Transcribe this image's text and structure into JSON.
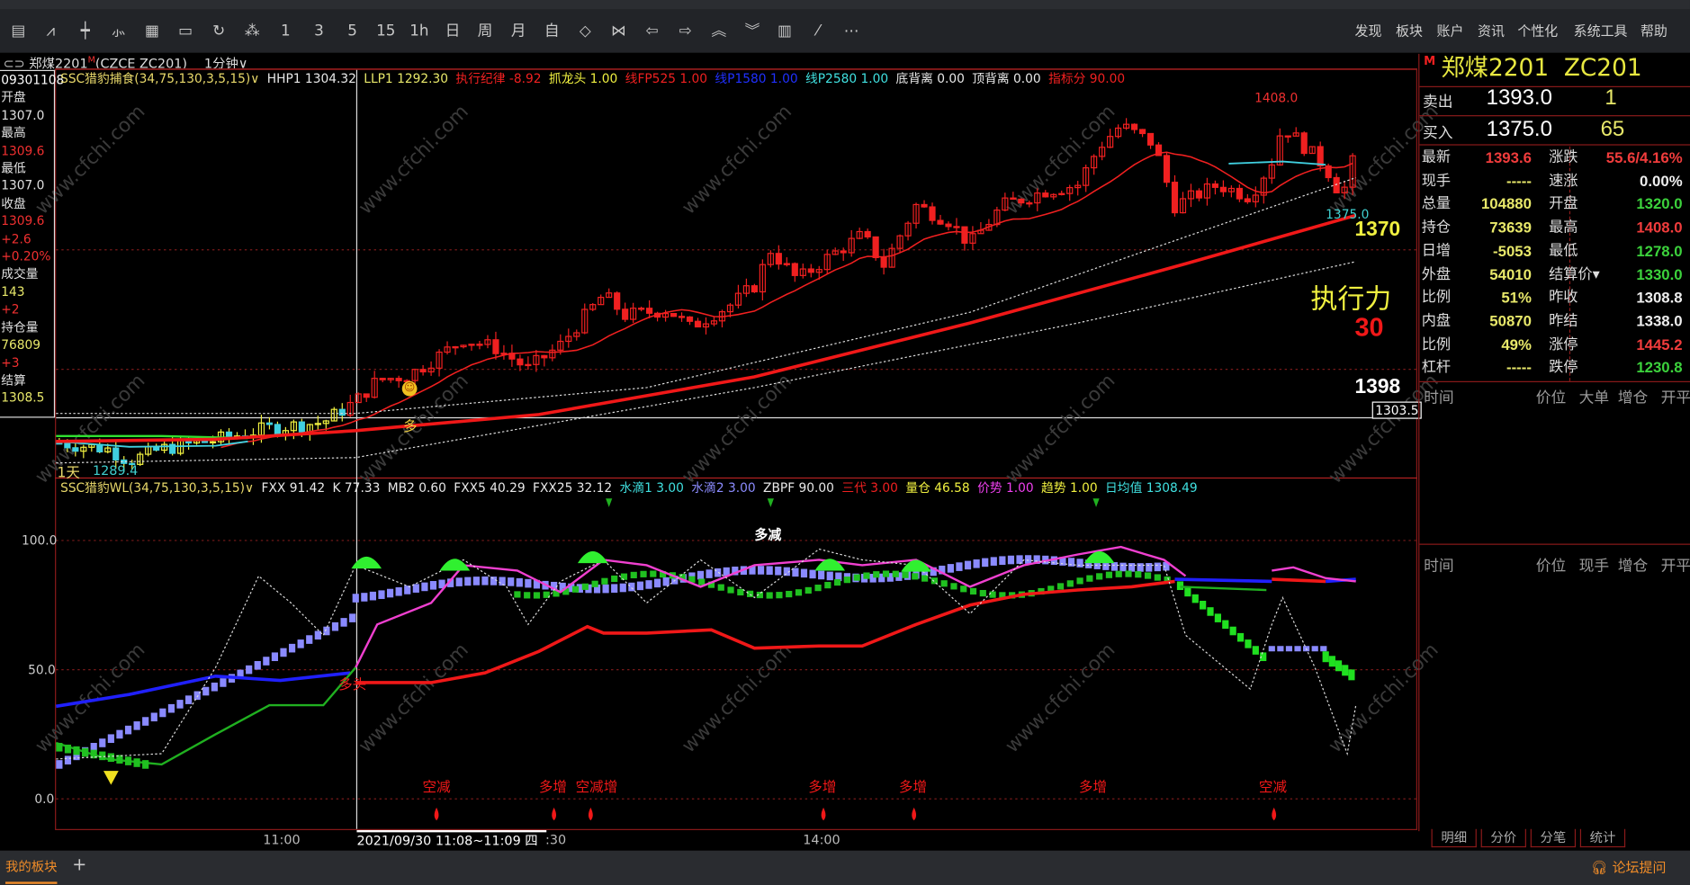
{
  "toolbar": {
    "icons": [
      "table-icon",
      "line-chart-icon",
      "candle-icon",
      "draw-icon",
      "stats-icon",
      "save-icon",
      "refresh-icon",
      "indicator-icon",
      "period-1-icon",
      "period-3-icon",
      "period-5-icon",
      "period-15-icon",
      "period-1h-icon",
      "period-day-icon",
      "period-week-icon",
      "period-month-icon",
      "period-custom-icon",
      "zoom-in-icon",
      "zoom-out-icon",
      "left-arrow-icon",
      "right-arrow-icon",
      "up-chevrons-icon",
      "down-chevrons-icon",
      "layout-icon",
      "pen-icon",
      "more-icon"
    ],
    "icon_glyphs": [
      "▤",
      "⩘",
      "┿",
      "⺗",
      "▦",
      "▭",
      "↻",
      "⁂",
      "1",
      "3",
      "5",
      "15",
      "1h",
      "日",
      "周",
      "月",
      "自",
      "◇",
      "⋈",
      "⇦",
      "⇨",
      "︽",
      "︾",
      "▥",
      "⁄",
      "⋯"
    ],
    "menu": [
      "发现",
      "板块",
      "账户",
      "资讯",
      "个性化",
      "系统工具",
      "帮助"
    ]
  },
  "symbol_bar": {
    "link_icon": "⊂⊃",
    "name": "郑煤2201",
    "flag": "M",
    "code": "(CZCE ZC201)",
    "period": "1分钟∨"
  },
  "main_indicator": {
    "name": {
      "text": "SSC猎豹捕食(34,75,130,3,5,15)∨",
      "color": "#e8d86a"
    },
    "items": [
      {
        "text": "HHP1 1304.32",
        "color": "#e8e8e8"
      },
      {
        "text": "LLP1 1292.30",
        "color": "#e8e86a"
      },
      {
        "text": "执行纪律 -8.92",
        "color": "#f02020"
      },
      {
        "text": "抓龙头 1.00",
        "color": "#f0f040"
      },
      {
        "text": "线FP525 1.00",
        "color": "#f02020"
      },
      {
        "text": "线P1580 1.00",
        "color": "#2030ff"
      },
      {
        "text": "线P2580 1.00",
        "color": "#40e0e0"
      },
      {
        "text": "底背离 0.00",
        "color": "#e8e8e8"
      },
      {
        "text": "顶背离 0.00",
        "color": "#e8e8e8"
      },
      {
        "text": "指标分 90.00",
        "color": "#f02020"
      }
    ]
  },
  "sub_indicator": {
    "name": {
      "text": "SSC猎豹WL(34,75,130,3,5,15)∨",
      "color": "#e8d86a"
    },
    "items": [
      {
        "text": "FXX 91.42",
        "color": "#e8e8e8"
      },
      {
        "text": "K 77.33",
        "color": "#e8e8e8"
      },
      {
        "text": "MB2 0.60",
        "color": "#e8e8e8"
      },
      {
        "text": "FXX5 40.29",
        "color": "#e8e8e8"
      },
      {
        "text": "FXX25 32.12",
        "color": "#e8e8e8"
      },
      {
        "text": "水滴1 3.00",
        "color": "#40e0e0"
      },
      {
        "text": "水滴2 3.00",
        "color": "#8c8cff"
      },
      {
        "text": "ZBPF 90.00",
        "color": "#e8e8e8"
      },
      {
        "text": "三代 3.00",
        "color": "#f02020"
      },
      {
        "text": "量仓 46.58",
        "color": "#f0f040"
      },
      {
        "text": "价势 1.00",
        "color": "#f040f0"
      },
      {
        "text": "趋势 1.00",
        "color": "#f0f040"
      },
      {
        "text": "日均值 1308.49",
        "color": "#40e0e0"
      }
    ]
  },
  "cursor_info": [
    {
      "text": "09301108",
      "color": "#ffffff"
    },
    {
      "text": "开盘",
      "color": "#e0e0e0"
    },
    {
      "text": "1307.0",
      "color": "#e0e0e0"
    },
    {
      "text": "最高",
      "color": "#e0e0e0"
    },
    {
      "text": "1309.6",
      "color": "#f03030"
    },
    {
      "text": "最低",
      "color": "#e0e0e0"
    },
    {
      "text": "1307.0",
      "color": "#e0e0e0"
    },
    {
      "text": "收盘",
      "color": "#e0e0e0"
    },
    {
      "text": "1309.6",
      "color": "#f03030"
    },
    {
      "text": "+2.6",
      "color": "#f03030"
    },
    {
      "text": "+0.20%",
      "color": "#f03030"
    },
    {
      "text": "成交量",
      "color": "#e0e0e0"
    },
    {
      "text": "143",
      "color": "#e8e86a"
    },
    {
      "text": "+2",
      "color": "#f03030"
    },
    {
      "text": "持仓量",
      "color": "#e0e0e0"
    },
    {
      "text": "76809",
      "color": "#e8e86a"
    },
    {
      "text": "+3",
      "color": "#f03030"
    },
    {
      "text": "结算",
      "color": "#e0e0e0"
    },
    {
      "text": "1308.5",
      "color": "#e8e86a"
    }
  ],
  "main_chart": {
    "high_label": "1408.0",
    "low_label": "1375.0",
    "price_1370": "1370",
    "exec_label": "执行力",
    "exec_value": "30",
    "price_1398": "1398",
    "cursor_price": "1303.5",
    "duo_label": "多",
    "day_label": "1天",
    "day_value": "1289.4"
  },
  "sub_chart": {
    "y_ticks": [
      "100.0",
      "50.0",
      "0.0"
    ],
    "duo_jian": "多减",
    "duo_tou": "多头",
    "signals": [
      "空减",
      "多增",
      "空减增",
      "多增",
      "多增",
      "多增",
      "空减"
    ]
  },
  "time_axis": {
    "labels": [
      "11:00",
      ":30",
      "14:00"
    ],
    "cursor_time": "2021/09/30 11:08~11:09 四"
  },
  "quote": {
    "flag": "M",
    "name": "郑煤2201",
    "code": "ZC201",
    "ask": {
      "label": "卖出",
      "price": "1393.0",
      "vol": "1"
    },
    "bid": {
      "label": "买入",
      "price": "1375.0",
      "vol": "65"
    },
    "rows": [
      {
        "l": "最新",
        "v": "1393.6",
        "vc": "#f03c3c",
        "l2": "涨跌",
        "v2": "55.6/4.16%",
        "v2c": "#f03c3c"
      },
      {
        "l": "现手",
        "v": "-----",
        "vc": "#e8e86a",
        "l2": "速涨",
        "v2": "0.00%",
        "v2c": "#eeeeee"
      },
      {
        "l": "总量",
        "v": "104880",
        "vc": "#e8e86a",
        "l2": "开盘",
        "v2": "1320.0",
        "v2c": "#3cd23c"
      },
      {
        "l": "持仓",
        "v": "73639",
        "vc": "#e8e86a",
        "l2": "最高",
        "v2": "1408.0",
        "v2c": "#f03c3c"
      },
      {
        "l": "日增",
        "v": "-5053",
        "vc": "#e8e86a",
        "l2": "最低",
        "v2": "1278.0",
        "v2c": "#3cd23c"
      },
      {
        "l": "外盘",
        "v": "54010",
        "vc": "#e8e86a",
        "l2": "结算价▾",
        "v2": "1330.0",
        "v2c": "#3cd23c"
      },
      {
        "l": "比例",
        "v": "51%",
        "vc": "#e8e86a",
        "l2": "昨收",
        "v2": "1308.8",
        "v2c": "#eeeeee"
      },
      {
        "l": "内盘",
        "v": "50870",
        "vc": "#e8e86a",
        "l2": "昨结",
        "v2": "1338.0",
        "v2c": "#eeeeee"
      },
      {
        "l": "比例",
        "v": "49%",
        "vc": "#e8e86a",
        "l2": "涨停",
        "v2": "1445.2",
        "v2c": "#f03c3c"
      },
      {
        "l": "杠杆",
        "v": "-----",
        "vc": "#e8e86a",
        "l2": "跌停",
        "v2": "1230.8",
        "v2c": "#3cd23c"
      }
    ],
    "list1_headers": [
      "时间",
      "价位",
      "大单",
      "增仓",
      "开平"
    ],
    "list2_headers": [
      "时间",
      "价位",
      "现手",
      "增仓",
      "开平"
    ],
    "tabs": [
      "明细",
      "分价",
      "分笔",
      "统计"
    ]
  },
  "bottom_bar": {
    "my_sector": "我的板块",
    "add": "+",
    "forum": "论坛提问"
  },
  "watermark": "www.cfchi.com"
}
